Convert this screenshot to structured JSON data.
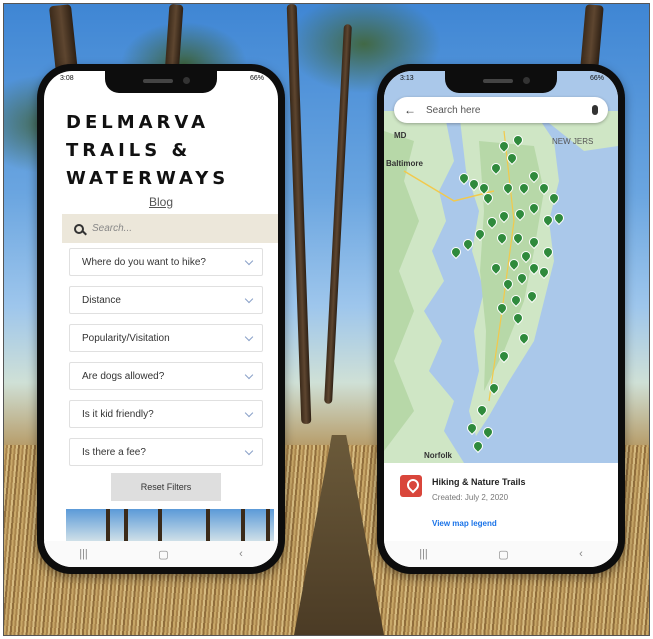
{
  "left_phone": {
    "status": {
      "time": "3:08",
      "battery": "66%"
    },
    "site_title_lines": [
      "DELMARVA",
      "TRAILS &",
      "WATERWAYS"
    ],
    "blog_link": "Blog",
    "search": {
      "placeholder": "Search..."
    },
    "filters": [
      "Where do you want to hike?",
      "Distance",
      "Popularity/Visitation",
      "Are dogs allowed?",
      "Is it kid friendly?",
      "Is there a fee?"
    ],
    "reset_label": "Reset Filters"
  },
  "right_phone": {
    "status": {
      "time": "3:13",
      "battery": "66%"
    },
    "map_search_placeholder": "Search here",
    "map_labels": {
      "new_jersey": "NEW JERS",
      "baltimore": "Baltimore",
      "norfolk": "Norfolk",
      "md": "MD"
    },
    "card": {
      "title": "Hiking & Nature Trails",
      "created": "Created: July 2, 2020",
      "legend_link": "View map legend"
    },
    "pin_color": "#2f8a3c"
  },
  "colors": {
    "reset_button_bg": "#dedede",
    "search_bar_bg": "#ece7da",
    "card_icon": "#d9463b",
    "link": "#1a73e8"
  }
}
